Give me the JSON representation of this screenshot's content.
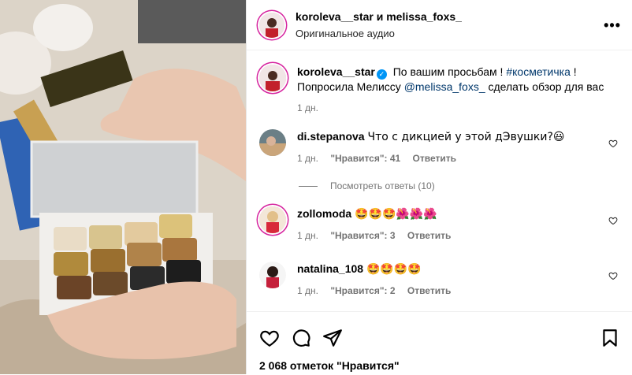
{
  "post": {
    "header_users": "koroleva__star и melissa_foxs_",
    "audio": "Оригинальное аудио",
    "more": "•••"
  },
  "caption": {
    "user": "koroleva__star",
    "text_a": "По вашим просьбам !",
    "hashtag": "#косметичка",
    "text_b": "! Попросила Мелиссу",
    "mention": "@melissa_foxs_",
    "text_c": "сделать обзор для вас",
    "time": "1 дн."
  },
  "comments": [
    {
      "user": "di.stepanova",
      "text": "Что с дикцией у этой дЭвушки?😃",
      "time": "1 дн.",
      "likes": "\"Нравится\": 41",
      "reply": "Ответить"
    },
    {
      "user": "zollomoda",
      "text": "🤩🤩🤩🌺🌺🌺",
      "time": "1 дн.",
      "likes": "\"Нравится\": 3",
      "reply": "Ответить"
    },
    {
      "user": "natalina_108",
      "text": "🤩🤩🤩🤩",
      "time": "1 дн.",
      "likes": "\"Нравится\": 2",
      "reply": "Ответить"
    }
  ],
  "view_replies": "Посмотреть ответы (10)",
  "likes_total": "2 068 отметок \"Нравится\"",
  "icons": [
    "heart-icon",
    "comment-icon",
    "share-icon",
    "bookmark-icon",
    "more-icon",
    "verified-icon"
  ],
  "colors": {
    "story_ring": "#d6249f",
    "link": "#00376b",
    "verified": "#0095f6",
    "meta": "#737373"
  }
}
